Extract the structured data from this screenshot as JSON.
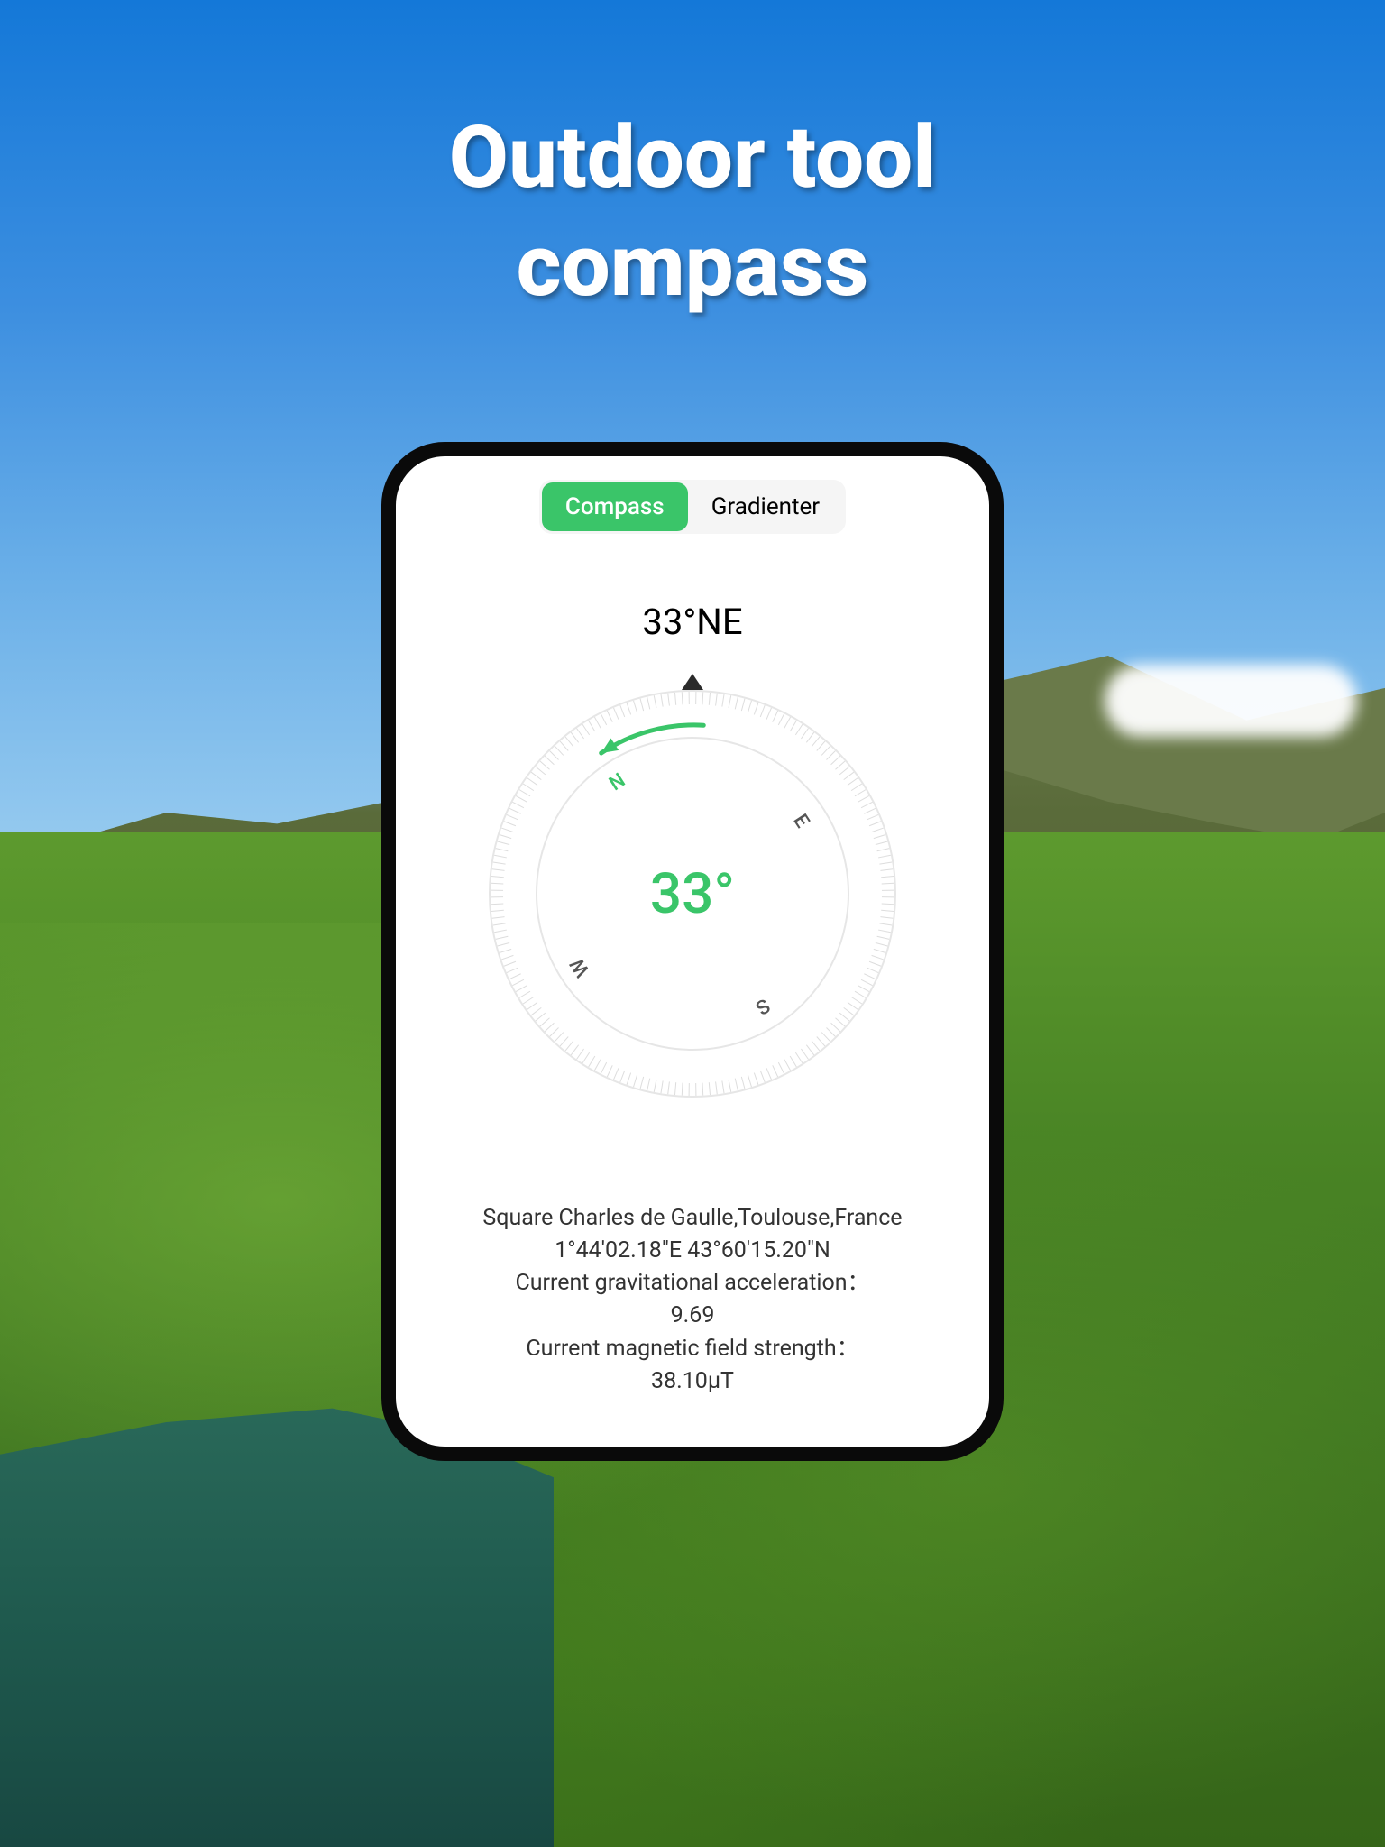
{
  "title": "Outdoor tool\ncompass",
  "tabs": {
    "compass": "Compass",
    "gradienter": "Gradienter"
  },
  "heading": {
    "display": "33°NE",
    "degrees": "33°",
    "rotation": -33
  },
  "compass": {
    "cardinals": {
      "n": "N",
      "e": "E",
      "s": "S",
      "w": "W"
    },
    "accent": "#3ac569"
  },
  "info": {
    "location": "Square Charles de Gaulle,Toulouse,France",
    "coordinates": "1°44'02.18\"E  43°60'15.20\"N",
    "gravity_label": "Current gravitational acceleration：",
    "gravity_value": "9.69",
    "magnetic_label": "Current magnetic field strength：",
    "magnetic_value": "38.10μT"
  }
}
